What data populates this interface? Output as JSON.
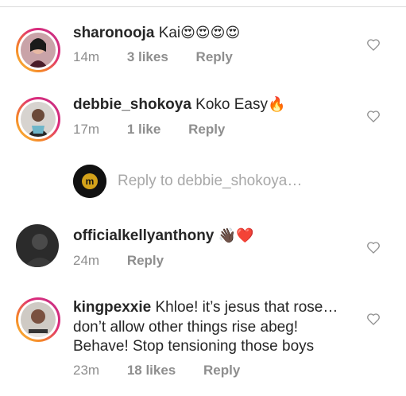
{
  "comments": [
    {
      "username": "sharonooja",
      "text": "Kai",
      "emoji": "😍😍😍😍",
      "time": "14m",
      "likes": "3 likes",
      "reply": "Reply",
      "has_story_ring": true
    },
    {
      "username": "debbie_shokoya",
      "text": "Koko Easy",
      "emoji": "🔥",
      "time": "17m",
      "likes": "1 like",
      "reply": "Reply",
      "has_story_ring": true
    },
    {
      "username": "officialkellyanthony",
      "text": "",
      "emoji": "👋🏿❤️",
      "time": "24m",
      "likes": "",
      "reply": "Reply",
      "has_story_ring": false
    },
    {
      "username": "kingpexxie",
      "line1": "Khloe! it’s jesus that rose…",
      "line2": "don’t allow other things rise abeg!",
      "line3": "Behave! Stop tensioning those boys",
      "time": "23m",
      "likes": "18 likes",
      "reply": "Reply",
      "has_story_ring": true
    }
  ],
  "reply_box": {
    "prompt": "Reply to debbie_shokoya…",
    "avatar_letter": "m"
  },
  "colors": {
    "text": "#262626",
    "meta": "#8e8e8e",
    "story_ring_start": "#f9c33b",
    "story_ring_end": "#c13584"
  },
  "icons": {
    "like": "heart-outline-icon"
  }
}
